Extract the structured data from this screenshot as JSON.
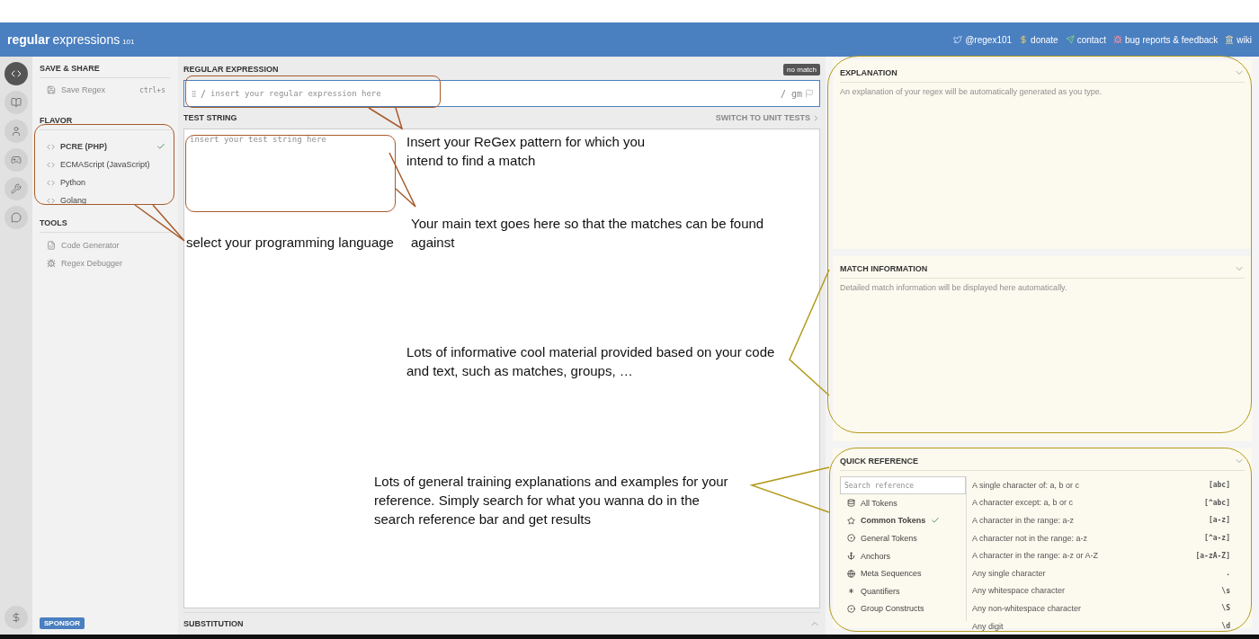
{
  "header": {
    "logo": [
      "regular",
      "expressions",
      "101"
    ],
    "links": [
      {
        "kind": "twitter",
        "label": "@regex101"
      },
      {
        "kind": "dollar",
        "label": "donate"
      },
      {
        "kind": "send",
        "label": "contact"
      },
      {
        "kind": "bug",
        "label": "bug reports & feedback"
      },
      {
        "kind": "wiki",
        "label": "wiki"
      }
    ]
  },
  "rail": [
    {
      "kind": "code",
      "selected": true
    },
    {
      "kind": "book",
      "selected": false
    },
    {
      "kind": "user",
      "selected": false
    },
    {
      "kind": "game",
      "selected": false
    },
    {
      "kind": "wrench",
      "selected": false
    },
    {
      "kind": "chat",
      "selected": false
    }
  ],
  "sidebar": {
    "save_title": "SAVE & SHARE",
    "save": {
      "label": "Save Regex",
      "shortcut": "ctrl+s",
      "disabled": true
    },
    "flavor_title": "FLAVOR",
    "flavors": [
      {
        "label": "PCRE (PHP)",
        "selected": true
      },
      {
        "label": "ECMAScript (JavaScript)",
        "selected": false
      },
      {
        "label": "Python",
        "selected": false
      },
      {
        "label": "Golang",
        "selected": false
      }
    ],
    "tools_title": "TOOLS",
    "tools": [
      {
        "kind": "code",
        "label": "Code Generator",
        "disabled": true
      },
      {
        "kind": "debug",
        "label": "Regex Debugger",
        "disabled": true
      }
    ],
    "sponsor": "SPONSOR"
  },
  "editor": {
    "regex_title": "REGULAR EXPRESSION",
    "status": "no match",
    "delimiter": "/",
    "placeholder": "insert your regular expression here",
    "flags": "/ gm",
    "test_title": "TEST STRING",
    "unit_tests": "SWITCH TO UNIT TESTS",
    "test_placeholder": "insert your test string here",
    "substitution": "SUBSTITUTION"
  },
  "explanation": {
    "title": "EXPLANATION",
    "text": "An explanation of your regex will be automatically generated as you type."
  },
  "match_information": {
    "title": "MATCH INFORMATION",
    "text": "Detailed match information will be displayed here automatically."
  },
  "quick_reference": {
    "title": "QUICK REFERENCE",
    "placeholder": "Search reference",
    "categories": [
      {
        "kind": "db",
        "label": "All Tokens",
        "selected": false
      },
      {
        "kind": "star",
        "label": "Common Tokens",
        "selected": true
      },
      {
        "kind": "target",
        "label": "General Tokens",
        "selected": false
      },
      {
        "kind": "anchor",
        "label": "Anchors",
        "selected": false
      },
      {
        "kind": "globe",
        "label": "Meta Sequences",
        "selected": false
      },
      {
        "kind": "asterisk",
        "label": "Quantifiers",
        "selected": false
      },
      {
        "kind": "target",
        "label": "Group Constructs",
        "selected": false
      }
    ],
    "tokens": [
      {
        "description": "A single character of: a, b or c",
        "token": "[abc]"
      },
      {
        "description": "A character except: a, b or c",
        "token": "[^abc]"
      },
      {
        "description": "A character in the range: a-z",
        "token": "[a-z]"
      },
      {
        "description": "A character not in the range: a-z",
        "token": "[^a-z]"
      },
      {
        "description": "A character in the range: a-z or A-Z",
        "token": "[a-zA-Z]"
      },
      {
        "description": "Any single character",
        "token": "."
      },
      {
        "description": "Any whitespace character",
        "token": "\\s"
      },
      {
        "description": "Any non-whitespace character",
        "token": "\\S"
      },
      {
        "description": "Any digit",
        "token": "\\d"
      }
    ]
  },
  "annotations": [
    {
      "kind": "regex",
      "text": "Insert your ReGex pattern for which you intend to find a match"
    },
    {
      "kind": "flavor",
      "text": "select your programming language"
    },
    {
      "kind": "test",
      "text": "Your main text goes here so that the matches can be found against"
    },
    {
      "kind": "info",
      "text": "Lots of informative cool material provided based on your code and text, such as matches, groups, …"
    },
    {
      "kind": "reference",
      "text": "Lots of general training explanations and examples for your reference. Simply search for what you wanna do in the search reference bar and get results"
    }
  ]
}
